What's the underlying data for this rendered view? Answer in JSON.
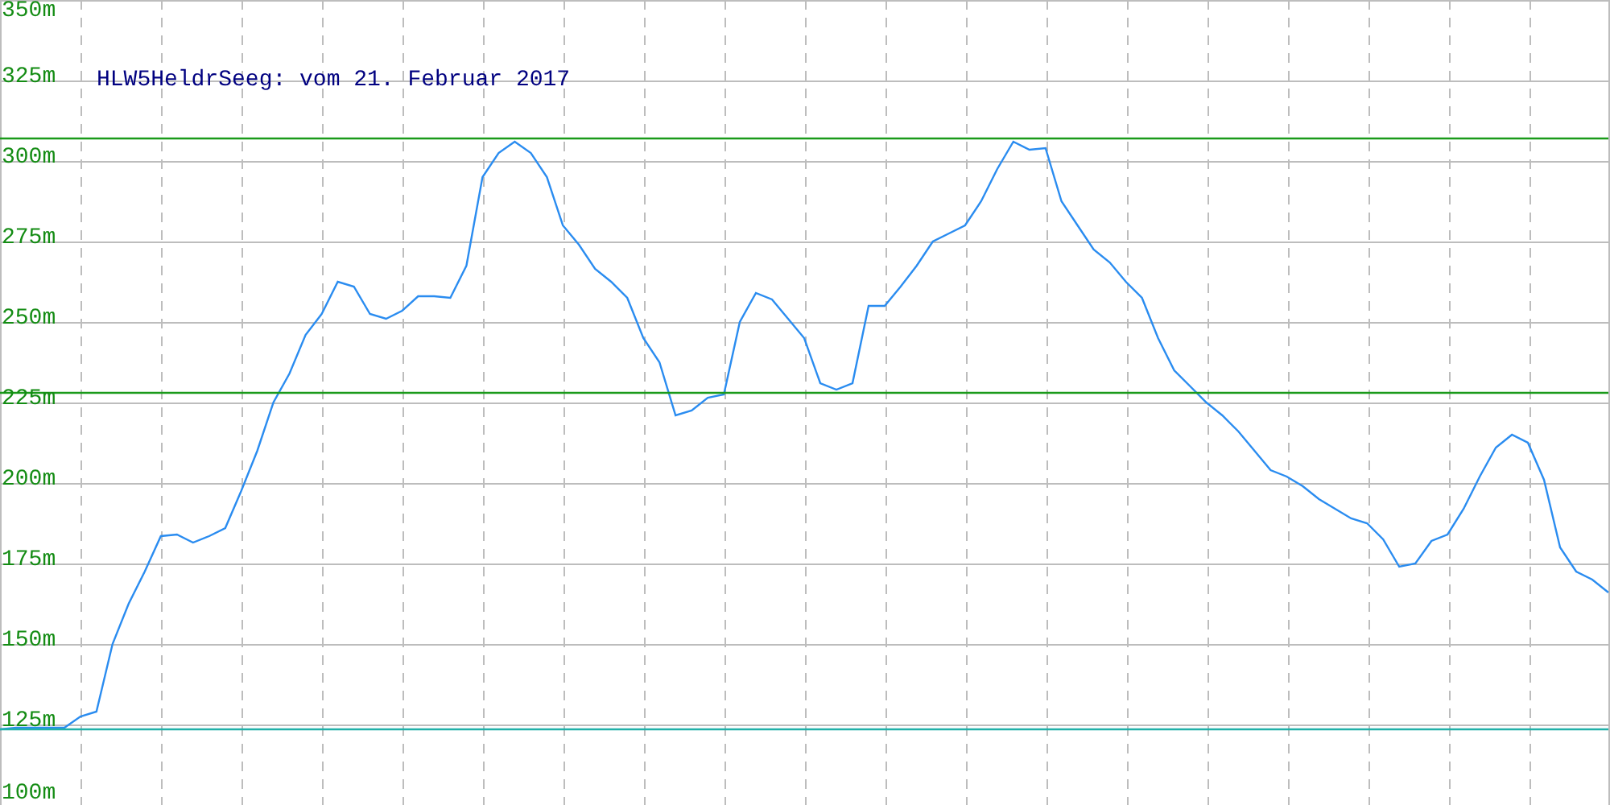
{
  "chart_data": {
    "type": "line",
    "title": "HLW5HeldrSeeg: vom 21. Februar 2017",
    "categories": [
      null,
      null,
      null,
      null,
      null,
      null,
      null,
      null,
      null,
      null,
      null,
      null,
      null,
      null,
      null,
      null,
      null,
      null,
      null,
      null,
      null,
      null,
      null,
      null,
      null,
      null,
      null,
      null,
      null,
      null,
      null,
      null,
      null,
      null,
      null,
      null,
      null,
      null,
      null,
      null,
      null,
      null,
      null,
      null,
      null,
      null,
      null,
      null,
      null,
      null,
      null,
      null,
      null,
      null,
      null,
      null,
      null,
      null,
      null,
      null,
      null,
      null,
      null,
      null,
      null,
      null,
      null,
      null,
      null,
      null,
      null,
      null,
      null,
      null,
      null,
      null,
      null,
      null,
      null,
      null,
      null,
      null,
      null,
      null,
      null,
      null,
      null,
      null,
      null,
      null,
      null,
      null,
      null,
      null,
      null,
      null,
      null,
      null,
      null,
      null,
      null
    ],
    "series": [
      {
        "color": "#2a8cf0",
        "values": [
          123.5,
          124,
          124,
          124,
          124,
          127.5,
          129,
          150,
          162.5,
          172.5,
          183.5,
          184,
          181.5,
          183.5,
          186,
          197.5,
          210,
          225,
          234,
          246,
          252.5,
          262.5,
          261,
          252.5,
          251,
          253.5,
          258,
          258,
          257.5,
          267.5,
          295,
          302.5,
          306,
          302.5,
          295,
          280,
          274,
          266.5,
          262.5,
          257.5,
          245,
          237.5,
          221,
          222.5,
          226.5,
          227.5,
          250,
          259,
          257,
          251,
          245,
          231,
          229,
          231,
          255,
          255,
          261,
          267.5,
          275,
          277.5,
          280,
          287.5,
          297.5,
          306,
          303.5,
          304,
          287.5,
          280,
          272.5,
          268.5,
          262.5,
          257.5,
          245,
          235,
          230,
          225,
          221,
          216,
          210,
          204,
          202,
          199,
          195,
          192,
          189,
          187.5,
          182.5,
          174,
          175,
          182,
          184,
          192,
          202,
          211,
          215,
          212.5,
          201,
          180,
          172.5,
          170,
          166
        ]
      },
      {
        "color": "#1a9a1a",
        "values": [
          307,
          307,
          307,
          307,
          307,
          307,
          307,
          307,
          307,
          307,
          307,
          307,
          307,
          307,
          307,
          307,
          307,
          307,
          307,
          307,
          307,
          307,
          307,
          307,
          307,
          307,
          307,
          307,
          307,
          307,
          307,
          307,
          307,
          307,
          307,
          307,
          307,
          307,
          307,
          307,
          307,
          307,
          307,
          307,
          307,
          307,
          307,
          307,
          307,
          307,
          307,
          307,
          307,
          307,
          307,
          307,
          307,
          307,
          307,
          307,
          307,
          307,
          307,
          307,
          307,
          307,
          307,
          307,
          307,
          307,
          307,
          307,
          307,
          307,
          307,
          307,
          307,
          307,
          307,
          307,
          307,
          307,
          307,
          307,
          307,
          307,
          307,
          307,
          307,
          307,
          307,
          307,
          307,
          307,
          307,
          307,
          307,
          307,
          307,
          307,
          307
        ]
      },
      {
        "color": "#1a9a1a",
        "values": [
          228,
          228,
          228,
          228,
          228,
          228,
          228,
          228,
          228,
          228,
          228,
          228,
          228,
          228,
          228,
          228,
          228,
          228,
          228,
          228,
          228,
          228,
          228,
          228,
          228,
          228,
          228,
          228,
          228,
          228,
          228,
          228,
          228,
          228,
          228,
          228,
          228,
          228,
          228,
          228,
          228,
          228,
          228,
          228,
          228,
          228,
          228,
          228,
          228,
          228,
          228,
          228,
          228,
          228,
          228,
          228,
          228,
          228,
          228,
          228,
          228,
          228,
          228,
          228,
          228,
          228,
          228,
          228,
          228,
          228,
          228,
          228,
          228,
          228,
          228,
          228,
          228,
          228,
          228,
          228,
          228,
          228,
          228,
          228,
          228,
          228,
          228,
          228,
          228,
          228,
          228,
          228,
          228,
          228,
          228,
          228,
          228,
          228,
          228,
          228,
          228
        ]
      },
      {
        "color": "#20b0a8",
        "values": [
          123.5,
          123.5,
          123.5,
          123.5,
          123.5,
          123.5,
          123.5,
          123.5,
          123.5,
          123.5,
          123.5,
          123.5,
          123.5,
          123.5,
          123.5,
          123.5,
          123.5,
          123.5,
          123.5,
          123.5,
          123.5,
          123.5,
          123.5,
          123.5,
          123.5,
          123.5,
          123.5,
          123.5,
          123.5,
          123.5,
          123.5,
          123.5,
          123.5,
          123.5,
          123.5,
          123.5,
          123.5,
          123.5,
          123.5,
          123.5,
          123.5,
          123.5,
          123.5,
          123.5,
          123.5,
          123.5,
          123.5,
          123.5,
          123.5,
          123.5,
          123.5,
          123.5,
          123.5,
          123.5,
          123.5,
          123.5,
          123.5,
          123.5,
          123.5,
          123.5,
          123.5,
          123.5,
          123.5,
          123.5,
          123.5,
          123.5,
          123.5,
          123.5,
          123.5,
          123.5,
          123.5,
          123.5,
          123.5,
          123.5,
          123.5,
          123.5,
          123.5,
          123.5,
          123.5,
          123.5,
          123.5,
          123.5,
          123.5,
          123.5,
          123.5,
          123.5,
          123.5,
          123.5,
          123.5,
          123.5,
          123.5,
          123.5,
          123.5,
          123.5,
          123.5,
          123.5,
          123.5,
          123.5,
          123.5,
          123.5,
          123.5
        ]
      }
    ],
    "ylim": [
      100,
      350
    ],
    "yticks": [
      {
        "value": 100,
        "label": "100m"
      },
      {
        "value": 125,
        "label": "125m"
      },
      {
        "value": 150,
        "label": "150m"
      },
      {
        "value": 175,
        "label": "175m"
      },
      {
        "value": 200,
        "label": "200m"
      },
      {
        "value": 225,
        "label": "225m"
      },
      {
        "value": 250,
        "label": "250m"
      },
      {
        "value": 275,
        "label": "275m"
      },
      {
        "value": 300,
        "label": "300m"
      },
      {
        "value": 325,
        "label": "325m"
      },
      {
        "value": 350,
        "label": "350m"
      }
    ],
    "grid": true
  }
}
